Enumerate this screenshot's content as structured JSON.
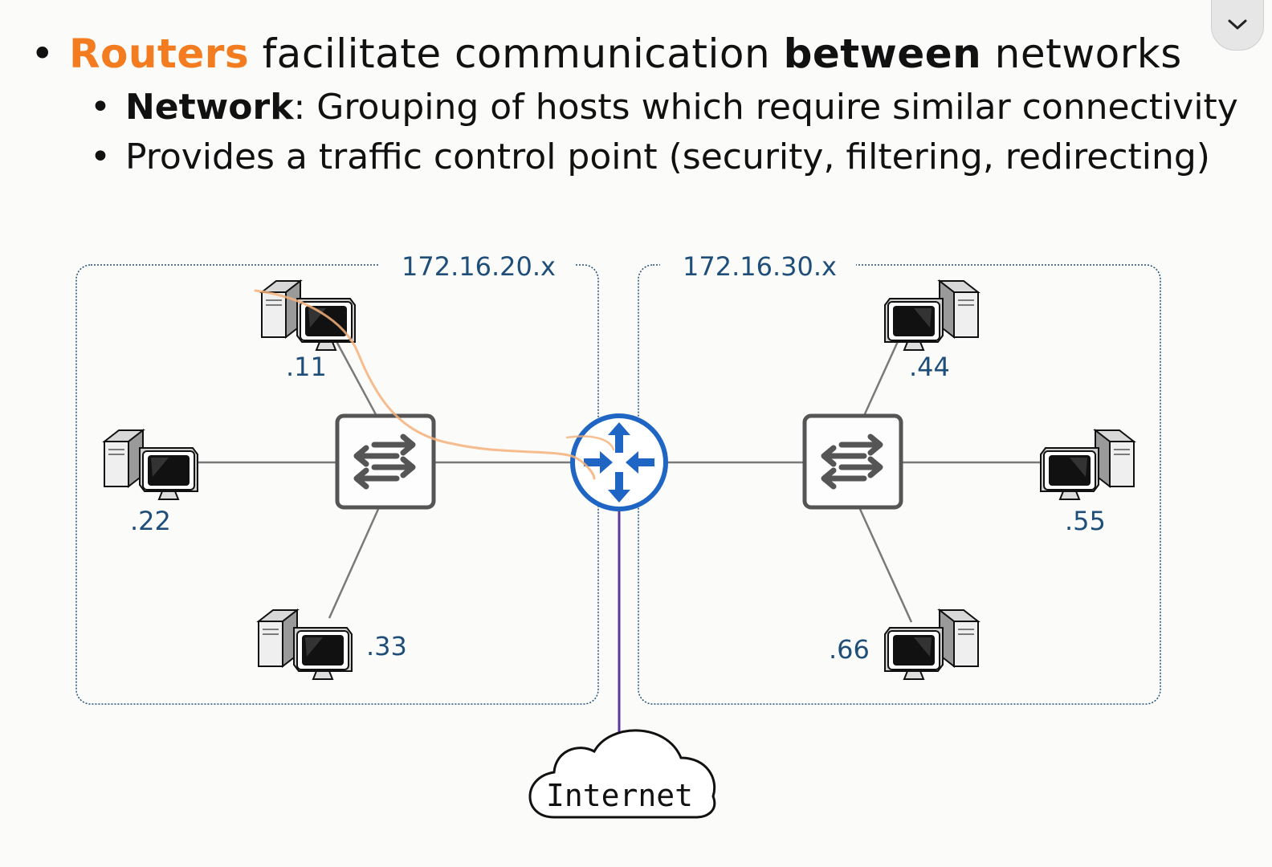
{
  "slide": {
    "bullet_main": {
      "prefix": "Routers",
      "middle": " facilitate communication ",
      "bold_word": "between",
      "suffix": " networks"
    },
    "sub_bullets": [
      {
        "bold": "Network",
        "text": ": Grouping of hosts which require similar connectivity"
      },
      {
        "bold": "",
        "text": "Provides a traffic control point (security, filtering, redirecting)"
      }
    ]
  },
  "diagram": {
    "network_left": {
      "label": "172.16.20.x",
      "hosts": [
        ".11",
        ".22",
        ".33"
      ]
    },
    "network_right": {
      "label": "172.16.30.x",
      "hosts": [
        ".44",
        ".55",
        ".66"
      ]
    },
    "internet_label": "Internet",
    "icons": {
      "router": "router-icon",
      "switch": "switch-icon",
      "host": "desktop-computer-icon",
      "cloud": "cloud-icon"
    },
    "colors": {
      "accent": "#f47c20",
      "label": "#1f4e79",
      "router": "#1f65c4",
      "uplink": "#5b3a9e",
      "annotation": "#f4b07a"
    }
  }
}
